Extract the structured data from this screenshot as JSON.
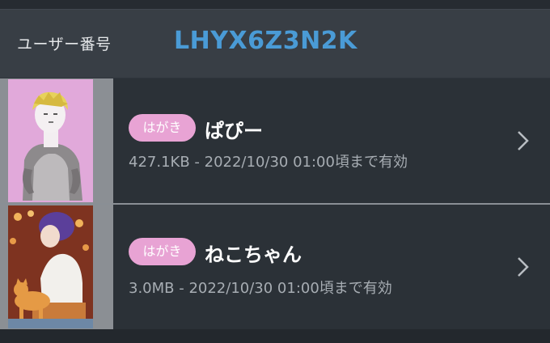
{
  "user": {
    "label": "ユーザー番号",
    "code": "LHYX6Z3N2K"
  },
  "items": [
    {
      "badge": "はがき",
      "title": "ぱぴー",
      "meta": "427.1KB - 2022/10/30 01:00頃まで有効",
      "thumbnail": "pink-portrait-thumbnail",
      "chevron": "chevron-right-icon"
    },
    {
      "badge": "はがき",
      "title": "ねこちゃん",
      "meta": "3.0MB - 2022/10/30 01:00頃まで有効",
      "thumbnail": "cat-illustration-thumbnail",
      "chevron": "chevron-right-icon"
    }
  ],
  "colors": {
    "background": "#2f353c",
    "header": "#383e45",
    "accent_code": "#4a9bd6",
    "badge": "#e8a3d4"
  }
}
